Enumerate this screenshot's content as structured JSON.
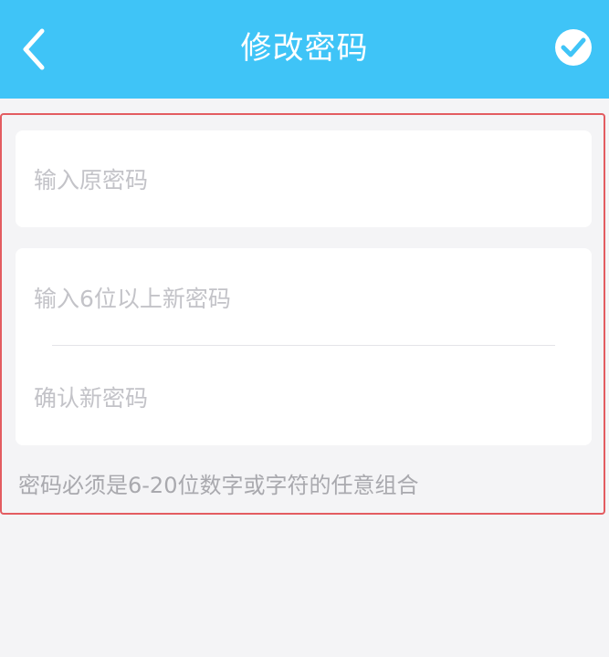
{
  "header": {
    "title": "修改密码",
    "back_icon": "chevron-left-icon",
    "confirm_icon": "check-circle-icon",
    "background_color": "#3fc4f7"
  },
  "form": {
    "old_password": {
      "value": "",
      "placeholder": "输入原密码"
    },
    "new_password": {
      "value": "",
      "placeholder": "输入6位以上新密码"
    },
    "confirm_password": {
      "value": "",
      "placeholder": "确认新密码"
    },
    "hint": "密码必须是6-20位数字或字符的任意组合"
  },
  "highlight_color": "#e35c61"
}
